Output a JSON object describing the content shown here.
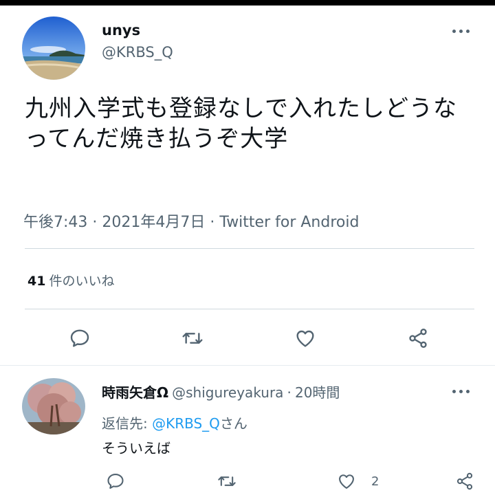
{
  "tweet": {
    "display_name": "unys",
    "handle": "@KRBS_Q",
    "text": "九州入学式も登録なしで入れたしどうなってんだ焼き払うぞ大学",
    "time": "午後7:43",
    "date": "2021年4月7日",
    "client": "Twitter for Android",
    "sep": "·",
    "likes_count": "41",
    "likes_label": "件のいいね"
  },
  "actions": [
    "reply-icon",
    "retweet-icon",
    "like-icon",
    "share-icon"
  ],
  "reply": {
    "display_name": "時雨矢倉Ω",
    "handle": "@shigureyakura",
    "sep": "·",
    "time": "20時間",
    "reply_to_label": "返信先:",
    "reply_to_handle": "@KRBS_Q",
    "reply_to_suffix": "さん",
    "text": "そういえば",
    "like_count": "2"
  },
  "colors": {
    "secondary": "#536471",
    "link": "#1d9bf0",
    "divider": "#cfd9de"
  }
}
